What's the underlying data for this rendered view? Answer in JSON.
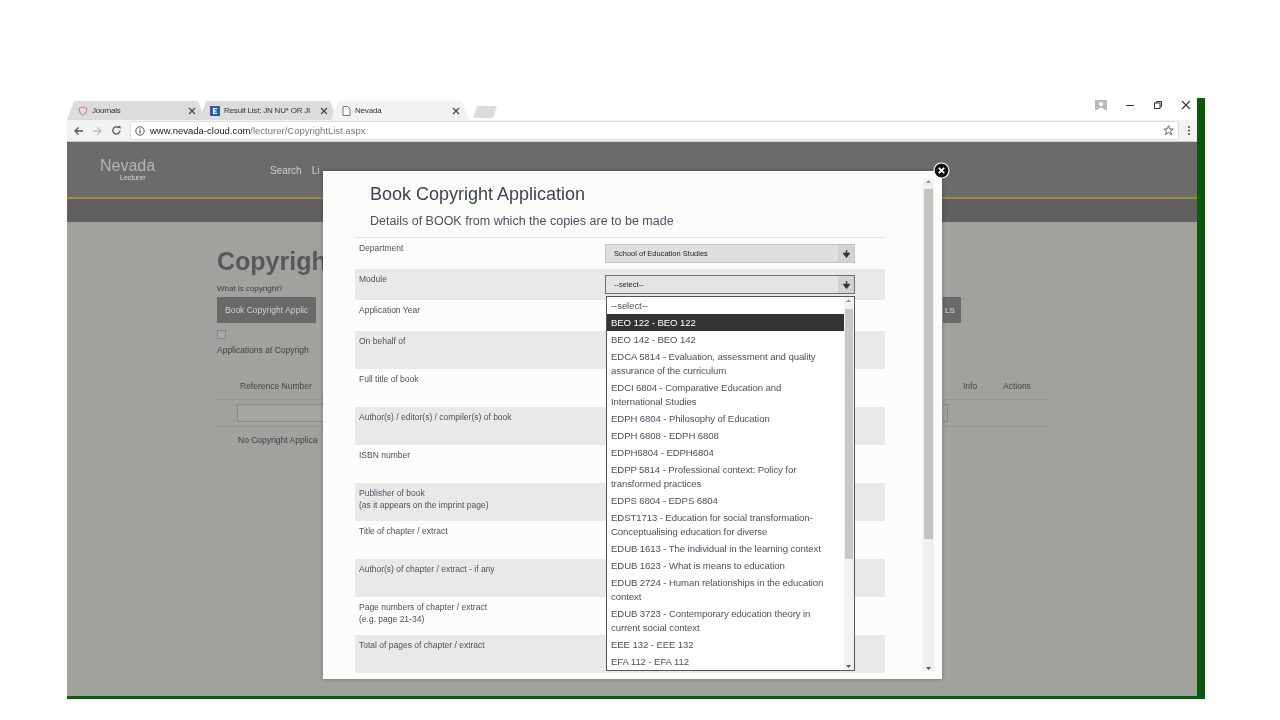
{
  "browser": {
    "tabs": [
      {
        "title": "Journals",
        "selected": false
      },
      {
        "title": "Result List: JN NU* OR JI",
        "selected": false
      },
      {
        "title": "Nevada",
        "selected": true
      }
    ],
    "url": {
      "host": "www.nevada-cloud.com",
      "path": "/lecturer/CopyrightList.aspx"
    }
  },
  "site": {
    "logo": "Nevada",
    "role": "Lecturer",
    "nav": [
      "Search",
      "Li"
    ]
  },
  "page": {
    "heading": "Copyrigh",
    "help_link": "What is copyright?",
    "buttons": [
      "Book Copyright Applic",
      "LS"
    ],
    "checkbox": {
      "checked": false
    },
    "checkbox_label": "Applications at Copyrigh",
    "table": {
      "columns": [
        "Reference Number",
        "Info",
        "Actions"
      ],
      "empty_message": "No Copyright Applica"
    }
  },
  "dialog": {
    "title": "Book Copyright Application",
    "subtitle": "Details of BOOK from which the copies are to be made",
    "fields": [
      {
        "label": "Department",
        "kind": "select",
        "value": "School of Education Studies",
        "expanded": false
      },
      {
        "label": "Module",
        "kind": "select",
        "value": "--select--",
        "expanded": true
      },
      {
        "label": "Application Year"
      },
      {
        "label": "On behalf of"
      },
      {
        "label": "Full title of book"
      },
      {
        "label": "Author(s) / editor(s) / compiler(s) of book"
      },
      {
        "label": "ISBN number"
      },
      {
        "label": "Publisher of book",
        "note": "(as it appears on the imprint page)"
      },
      {
        "label": "Title of chapter / extract"
      },
      {
        "label": "Author(s) of chapter / extract - if any"
      },
      {
        "label": "Page numbers of chapter / extract",
        "note": "(e.g. page 21-34)"
      },
      {
        "label": "Total of pages of chapter / extract"
      }
    ],
    "module_options": [
      {
        "text": "--select--",
        "selected": false
      },
      {
        "text": "BEO 122 - BEO 122",
        "selected": true
      },
      {
        "text": "BEO 142 - BEO 142",
        "selected": false
      },
      {
        "text": "EDCA 5814 - Evaluation, assessment and quality assurance of the curriculum",
        "selected": false
      },
      {
        "text": "EDCI 6804 - Comparative Education and International Studies",
        "selected": false
      },
      {
        "text": "EDPH 6804 - Philosophy of Education",
        "selected": false
      },
      {
        "text": "EDPH 6808 - EDPH 6808",
        "selected": false
      },
      {
        "text": "EDPH6804 - EDPH6804",
        "selected": false
      },
      {
        "text": "EDPP 5814 - Professional context: Policy for transformed practices",
        "selected": false
      },
      {
        "text": "EDPS 6804 - EDPS 6804",
        "selected": false
      },
      {
        "text": "EDST1713 - Education for social transformation-Conceptualising education for diverse",
        "selected": false
      },
      {
        "text": "EDUB 1613 - The individual in the learning context",
        "selected": false
      },
      {
        "text": "EDUB 1623 - What is means to education",
        "selected": false
      },
      {
        "text": "EDUB 2724 - Human relationships in the education context",
        "selected": false
      },
      {
        "text": "EDUB 3723 - Contemporary education theory in current social context",
        "selected": false
      },
      {
        "text": "EEE 132 - EEE 132",
        "selected": false
      },
      {
        "text": "EFA 112 - EFA 112",
        "selected": false
      }
    ]
  }
}
